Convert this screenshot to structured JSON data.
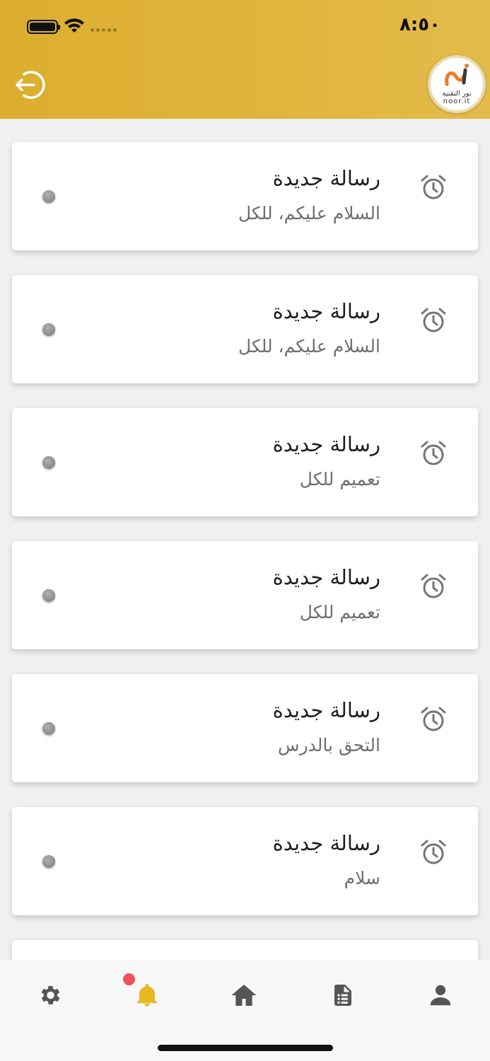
{
  "status_bar": {
    "time": "٨:٥٠"
  },
  "header": {
    "logo": {
      "name_ar": "نور التقنية",
      "name_en": "noor.it"
    }
  },
  "notifications": [
    {
      "title": "رسالة جديدة",
      "body": "السلام عليكم، للكل"
    },
    {
      "title": "رسالة جديدة",
      "body": "السلام عليكم، للكل"
    },
    {
      "title": "رسالة جديدة",
      "body": "تعميم للكل"
    },
    {
      "title": "رسالة جديدة",
      "body": "تعميم للكل"
    },
    {
      "title": "رسالة جديدة",
      "body": "التحق بالدرس"
    },
    {
      "title": "رسالة جديدة",
      "body": "سلام"
    },
    {
      "title": "",
      "body": ""
    }
  ],
  "colors": {
    "header_gradient_start": "#dcae2e",
    "header_gradient_end": "#e3bb4a",
    "active_tab": "#e8b820",
    "inactive_tab": "#555555",
    "badge": "#f0525a"
  },
  "tabbar": {
    "items": [
      {
        "name": "settings",
        "icon": "gear-icon",
        "active": false
      },
      {
        "name": "notifications",
        "icon": "bell-icon",
        "active": true,
        "has_badge": true
      },
      {
        "name": "home",
        "icon": "home-icon",
        "active": false
      },
      {
        "name": "reports",
        "icon": "document-list-icon",
        "active": false
      },
      {
        "name": "profile",
        "icon": "person-icon",
        "active": false
      }
    ]
  }
}
